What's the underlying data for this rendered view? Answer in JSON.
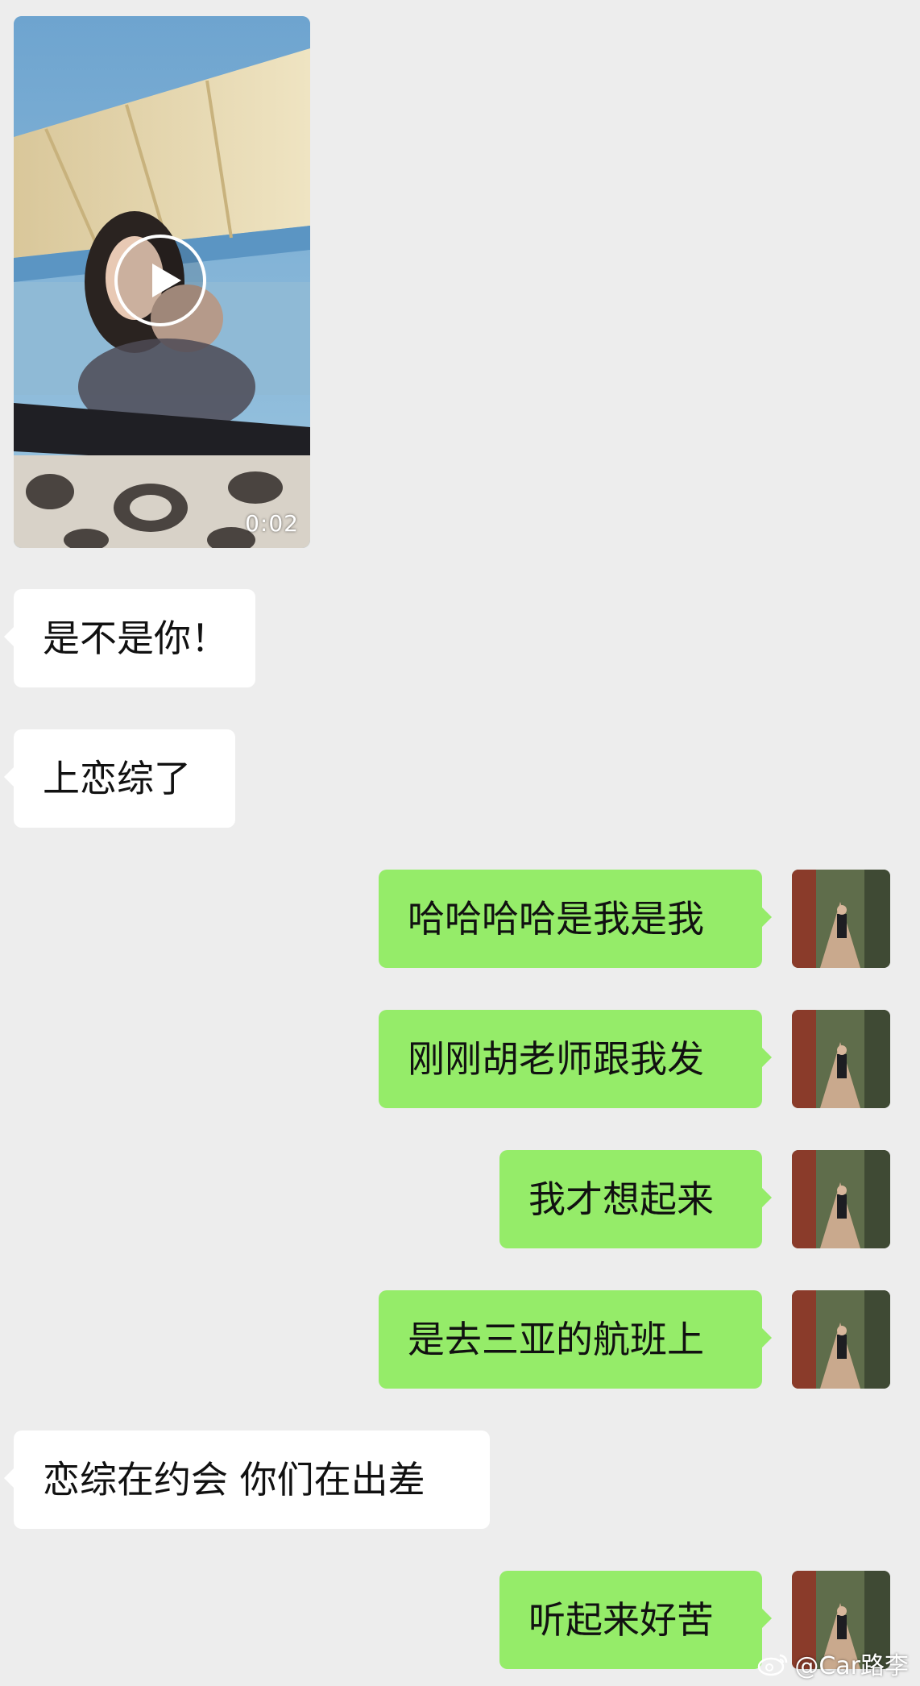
{
  "video_message": {
    "duration": "0:02",
    "sender": "other"
  },
  "messages": [
    {
      "sender": "other",
      "text": "是不是你！"
    },
    {
      "sender": "other",
      "text": "上恋综了"
    },
    {
      "sender": "me",
      "text": "哈哈哈哈是我是我"
    },
    {
      "sender": "me",
      "text": "刚刚胡老师跟我发"
    },
    {
      "sender": "me",
      "text": "我才想起来"
    },
    {
      "sender": "me",
      "text": "是去三亚的航班上"
    },
    {
      "sender": "other",
      "text": "恋综在约会 你们在出差"
    },
    {
      "sender": "me",
      "text": "听起来好苦"
    }
  ],
  "watermark": {
    "text": "@Car路李",
    "icon": "weibo-icon"
  },
  "colors": {
    "background": "#ededed",
    "incoming_bubble": "#ffffff",
    "outgoing_bubble": "#95ec69"
  }
}
